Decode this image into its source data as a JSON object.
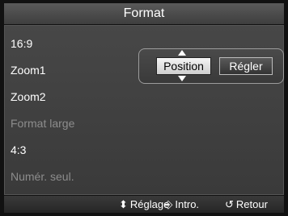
{
  "window": {
    "title": "Format"
  },
  "menu": {
    "items": [
      {
        "label": "16:9",
        "state": "enabled"
      },
      {
        "label": "Zoom1",
        "state": "enabled"
      },
      {
        "label": "Zoom2",
        "state": "enabled"
      },
      {
        "label": "Format large",
        "state": "disabled"
      },
      {
        "label": "4:3",
        "state": "enabled"
      },
      {
        "label": "Numér. seul.",
        "state": "disabled"
      }
    ]
  },
  "popup": {
    "position_label": "Position",
    "regler_label": "Régler"
  },
  "footer": {
    "hints": [
      {
        "icon": "updown-icon",
        "glyph": "⬍",
        "label": "Réglage"
      },
      {
        "icon": "enter-icon",
        "glyph": "⎆",
        "label": "Intro."
      },
      {
        "icon": "return-icon",
        "glyph": "↺",
        "label": "Retour"
      }
    ]
  },
  "colors": {
    "text": "#ffffff",
    "disabled": "#8d8d8d",
    "panel": "#424242"
  }
}
